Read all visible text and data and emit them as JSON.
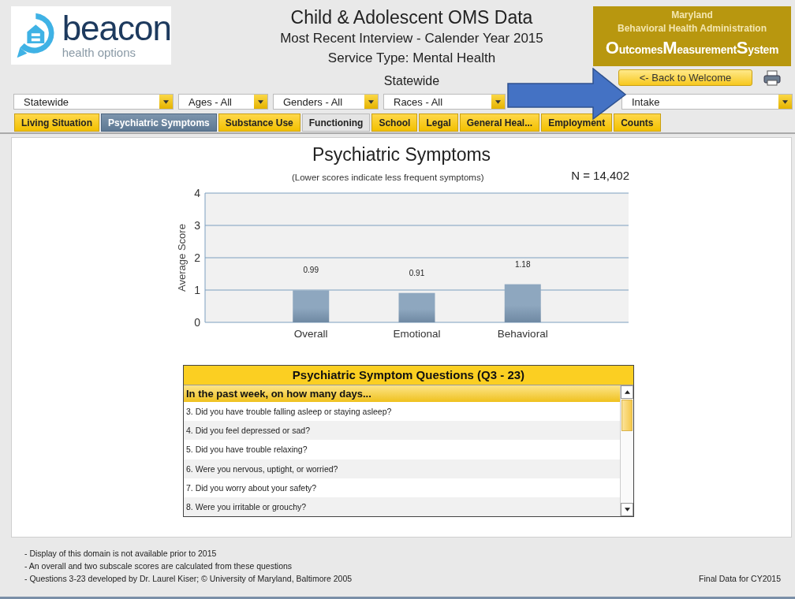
{
  "logo": {
    "name": "beacon",
    "tagline": "health options"
  },
  "header": {
    "title": "Child & Adolescent OMS Data",
    "lines": [
      "Most Recent Interview - Calender Year 2015",
      "Service Type: Mental Health"
    ],
    "region": "Statewide"
  },
  "agency": {
    "state": "Maryland",
    "name": "Behavioral Health Administration",
    "acronym": [
      {
        "initial": "O",
        "rest": "utcomes"
      },
      {
        "initial": "M",
        "rest": "easurement"
      },
      {
        "initial": "S",
        "rest": "ystem"
      }
    ]
  },
  "back_button": "<- Back to Welcome",
  "filters": [
    {
      "value": "Statewide"
    },
    {
      "value": "Ages - All"
    },
    {
      "value": "Genders - All"
    },
    {
      "value": "Races - All"
    },
    {
      "value": "Intake"
    }
  ],
  "tabs": [
    {
      "label": "Living Situation",
      "selected": false
    },
    {
      "label": "Psychiatric Symptoms",
      "selected": true
    },
    {
      "label": "Substance Use",
      "selected": false
    },
    {
      "label": "Functioning",
      "selected": false,
      "disabled": true
    },
    {
      "label": "School",
      "selected": false
    },
    {
      "label": "Legal",
      "selected": false
    },
    {
      "label": "General Heal...",
      "selected": false
    },
    {
      "label": "Employment",
      "selected": false
    },
    {
      "label": "Counts",
      "selected": false
    }
  ],
  "chart": {
    "subtitle": "(Lower scores indicate less frequent symptoms)",
    "n": "N = 14,402",
    "chart_data": {
      "type": "bar",
      "title": "Psychiatric Symptoms",
      "ylabel": "Average Score",
      "categories": [
        "Overall",
        "Emotional",
        "Behavioral"
      ],
      "values": [
        0.99,
        0.91,
        1.18
      ],
      "ylim": [
        0,
        4
      ],
      "yticks": [
        0,
        1,
        2,
        3,
        4
      ],
      "grid": true,
      "data_labels": true
    }
  },
  "questions": {
    "title": "Psychiatric Symptom Questions (Q3 - 23)",
    "header": "In the past week, on how many days...",
    "rows": [
      "3. Did you have trouble falling asleep or staying asleep?",
      "4. Did you feel depressed or sad?",
      "5. Did you have trouble relaxing?",
      "6. Were you nervous, uptight, or worried?",
      "7. Did you worry about your safety?",
      "8. Were you irritable or grouchy?"
    ]
  },
  "notes": [
    "- Display of this domain is not available prior to 2015",
    "- An overall and two subscale scores are calculated from these questions",
    "- Questions 3-23 developed by Dr. Laurel Kiser; © University of Maryland, Baltimore 2005"
  ],
  "final_note": "Final Data for CY2015"
}
